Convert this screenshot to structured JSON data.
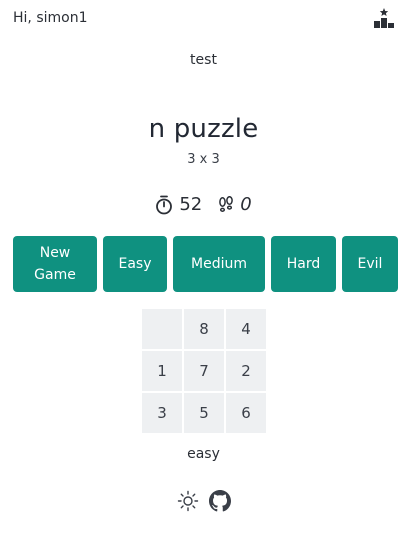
{
  "header": {
    "greeting": "Hi, simon1",
    "leaderboard_icon": "leaderboard-icon"
  },
  "subtitle": "test",
  "title": "n puzzle",
  "size_label": "3 x 3",
  "stats": {
    "timer_icon": "stopwatch-icon",
    "time": "52",
    "moves_icon": "footsteps-icon",
    "moves": "0"
  },
  "buttons": {
    "new_game": "New\nGame",
    "easy": "Easy",
    "medium": "Medium",
    "hard": "Hard",
    "evil": "Evil"
  },
  "accent_color": "#0f9180",
  "board": {
    "tiles": [
      "",
      "8",
      "4",
      "1",
      "7",
      "2",
      "3",
      "5",
      "6"
    ]
  },
  "difficulty": "easy",
  "footer": {
    "theme_icon": "sun-icon",
    "github_icon": "github-icon"
  }
}
